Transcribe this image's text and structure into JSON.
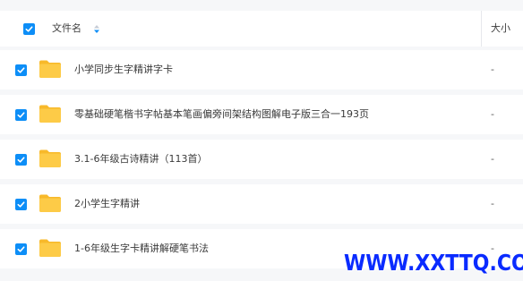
{
  "header": {
    "name_label": "文件名",
    "size_label": "大小",
    "select_all_checked": true
  },
  "rows": [
    {
      "name": "小学同步生字精讲字卡",
      "size": "-",
      "checked": true
    },
    {
      "name": "零基础硬笔楷书字帖基本笔画偏旁间架结构图解电子版三合一193页",
      "size": "-",
      "checked": true
    },
    {
      "name": "3.1-6年级古诗精讲（113首）",
      "size": "-",
      "checked": true
    },
    {
      "name": "2小学生字精讲",
      "size": "-",
      "checked": true
    },
    {
      "name": "1-6年级生字卡精讲解硬笔书法",
      "size": "-",
      "checked": true
    }
  ],
  "watermark": "WWW.XXTTQ.COM",
  "colors": {
    "accent": "#0d8ef7",
    "folder": "#fcc43c",
    "watermark": "#0a2bff"
  }
}
